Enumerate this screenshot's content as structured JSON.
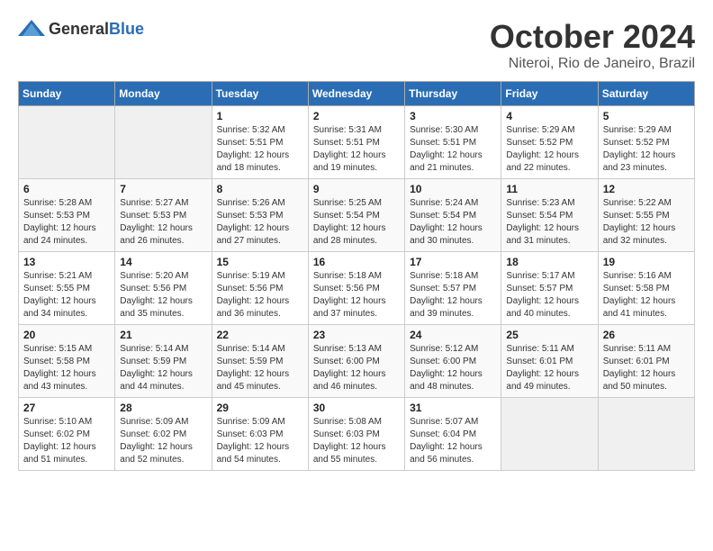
{
  "logo": {
    "text_general": "General",
    "text_blue": "Blue"
  },
  "title": "October 2024",
  "subtitle": "Niteroi, Rio de Janeiro, Brazil",
  "days_of_week": [
    "Sunday",
    "Monday",
    "Tuesday",
    "Wednesday",
    "Thursday",
    "Friday",
    "Saturday"
  ],
  "weeks": [
    [
      {
        "day": "",
        "sunrise": "",
        "sunset": "",
        "daylight": "",
        "empty": true
      },
      {
        "day": "",
        "sunrise": "",
        "sunset": "",
        "daylight": "",
        "empty": true
      },
      {
        "day": "1",
        "sunrise": "Sunrise: 5:32 AM",
        "sunset": "Sunset: 5:51 PM",
        "daylight": "Daylight: 12 hours and 18 minutes.",
        "empty": false
      },
      {
        "day": "2",
        "sunrise": "Sunrise: 5:31 AM",
        "sunset": "Sunset: 5:51 PM",
        "daylight": "Daylight: 12 hours and 19 minutes.",
        "empty": false
      },
      {
        "day": "3",
        "sunrise": "Sunrise: 5:30 AM",
        "sunset": "Sunset: 5:51 PM",
        "daylight": "Daylight: 12 hours and 21 minutes.",
        "empty": false
      },
      {
        "day": "4",
        "sunrise": "Sunrise: 5:29 AM",
        "sunset": "Sunset: 5:52 PM",
        "daylight": "Daylight: 12 hours and 22 minutes.",
        "empty": false
      },
      {
        "day": "5",
        "sunrise": "Sunrise: 5:29 AM",
        "sunset": "Sunset: 5:52 PM",
        "daylight": "Daylight: 12 hours and 23 minutes.",
        "empty": false
      }
    ],
    [
      {
        "day": "6",
        "sunrise": "Sunrise: 5:28 AM",
        "sunset": "Sunset: 5:53 PM",
        "daylight": "Daylight: 12 hours and 24 minutes.",
        "empty": false
      },
      {
        "day": "7",
        "sunrise": "Sunrise: 5:27 AM",
        "sunset": "Sunset: 5:53 PM",
        "daylight": "Daylight: 12 hours and 26 minutes.",
        "empty": false
      },
      {
        "day": "8",
        "sunrise": "Sunrise: 5:26 AM",
        "sunset": "Sunset: 5:53 PM",
        "daylight": "Daylight: 12 hours and 27 minutes.",
        "empty": false
      },
      {
        "day": "9",
        "sunrise": "Sunrise: 5:25 AM",
        "sunset": "Sunset: 5:54 PM",
        "daylight": "Daylight: 12 hours and 28 minutes.",
        "empty": false
      },
      {
        "day": "10",
        "sunrise": "Sunrise: 5:24 AM",
        "sunset": "Sunset: 5:54 PM",
        "daylight": "Daylight: 12 hours and 30 minutes.",
        "empty": false
      },
      {
        "day": "11",
        "sunrise": "Sunrise: 5:23 AM",
        "sunset": "Sunset: 5:54 PM",
        "daylight": "Daylight: 12 hours and 31 minutes.",
        "empty": false
      },
      {
        "day": "12",
        "sunrise": "Sunrise: 5:22 AM",
        "sunset": "Sunset: 5:55 PM",
        "daylight": "Daylight: 12 hours and 32 minutes.",
        "empty": false
      }
    ],
    [
      {
        "day": "13",
        "sunrise": "Sunrise: 5:21 AM",
        "sunset": "Sunset: 5:55 PM",
        "daylight": "Daylight: 12 hours and 34 minutes.",
        "empty": false
      },
      {
        "day": "14",
        "sunrise": "Sunrise: 5:20 AM",
        "sunset": "Sunset: 5:56 PM",
        "daylight": "Daylight: 12 hours and 35 minutes.",
        "empty": false
      },
      {
        "day": "15",
        "sunrise": "Sunrise: 5:19 AM",
        "sunset": "Sunset: 5:56 PM",
        "daylight": "Daylight: 12 hours and 36 minutes.",
        "empty": false
      },
      {
        "day": "16",
        "sunrise": "Sunrise: 5:18 AM",
        "sunset": "Sunset: 5:56 PM",
        "daylight": "Daylight: 12 hours and 37 minutes.",
        "empty": false
      },
      {
        "day": "17",
        "sunrise": "Sunrise: 5:18 AM",
        "sunset": "Sunset: 5:57 PM",
        "daylight": "Daylight: 12 hours and 39 minutes.",
        "empty": false
      },
      {
        "day": "18",
        "sunrise": "Sunrise: 5:17 AM",
        "sunset": "Sunset: 5:57 PM",
        "daylight": "Daylight: 12 hours and 40 minutes.",
        "empty": false
      },
      {
        "day": "19",
        "sunrise": "Sunrise: 5:16 AM",
        "sunset": "Sunset: 5:58 PM",
        "daylight": "Daylight: 12 hours and 41 minutes.",
        "empty": false
      }
    ],
    [
      {
        "day": "20",
        "sunrise": "Sunrise: 5:15 AM",
        "sunset": "Sunset: 5:58 PM",
        "daylight": "Daylight: 12 hours and 43 minutes.",
        "empty": false
      },
      {
        "day": "21",
        "sunrise": "Sunrise: 5:14 AM",
        "sunset": "Sunset: 5:59 PM",
        "daylight": "Daylight: 12 hours and 44 minutes.",
        "empty": false
      },
      {
        "day": "22",
        "sunrise": "Sunrise: 5:14 AM",
        "sunset": "Sunset: 5:59 PM",
        "daylight": "Daylight: 12 hours and 45 minutes.",
        "empty": false
      },
      {
        "day": "23",
        "sunrise": "Sunrise: 5:13 AM",
        "sunset": "Sunset: 6:00 PM",
        "daylight": "Daylight: 12 hours and 46 minutes.",
        "empty": false
      },
      {
        "day": "24",
        "sunrise": "Sunrise: 5:12 AM",
        "sunset": "Sunset: 6:00 PM",
        "daylight": "Daylight: 12 hours and 48 minutes.",
        "empty": false
      },
      {
        "day": "25",
        "sunrise": "Sunrise: 5:11 AM",
        "sunset": "Sunset: 6:01 PM",
        "daylight": "Daylight: 12 hours and 49 minutes.",
        "empty": false
      },
      {
        "day": "26",
        "sunrise": "Sunrise: 5:11 AM",
        "sunset": "Sunset: 6:01 PM",
        "daylight": "Daylight: 12 hours and 50 minutes.",
        "empty": false
      }
    ],
    [
      {
        "day": "27",
        "sunrise": "Sunrise: 5:10 AM",
        "sunset": "Sunset: 6:02 PM",
        "daylight": "Daylight: 12 hours and 51 minutes.",
        "empty": false
      },
      {
        "day": "28",
        "sunrise": "Sunrise: 5:09 AM",
        "sunset": "Sunset: 6:02 PM",
        "daylight": "Daylight: 12 hours and 52 minutes.",
        "empty": false
      },
      {
        "day": "29",
        "sunrise": "Sunrise: 5:09 AM",
        "sunset": "Sunset: 6:03 PM",
        "daylight": "Daylight: 12 hours and 54 minutes.",
        "empty": false
      },
      {
        "day": "30",
        "sunrise": "Sunrise: 5:08 AM",
        "sunset": "Sunset: 6:03 PM",
        "daylight": "Daylight: 12 hours and 55 minutes.",
        "empty": false
      },
      {
        "day": "31",
        "sunrise": "Sunrise: 5:07 AM",
        "sunset": "Sunset: 6:04 PM",
        "daylight": "Daylight: 12 hours and 56 minutes.",
        "empty": false
      },
      {
        "day": "",
        "sunrise": "",
        "sunset": "",
        "daylight": "",
        "empty": true
      },
      {
        "day": "",
        "sunrise": "",
        "sunset": "",
        "daylight": "",
        "empty": true
      }
    ]
  ]
}
